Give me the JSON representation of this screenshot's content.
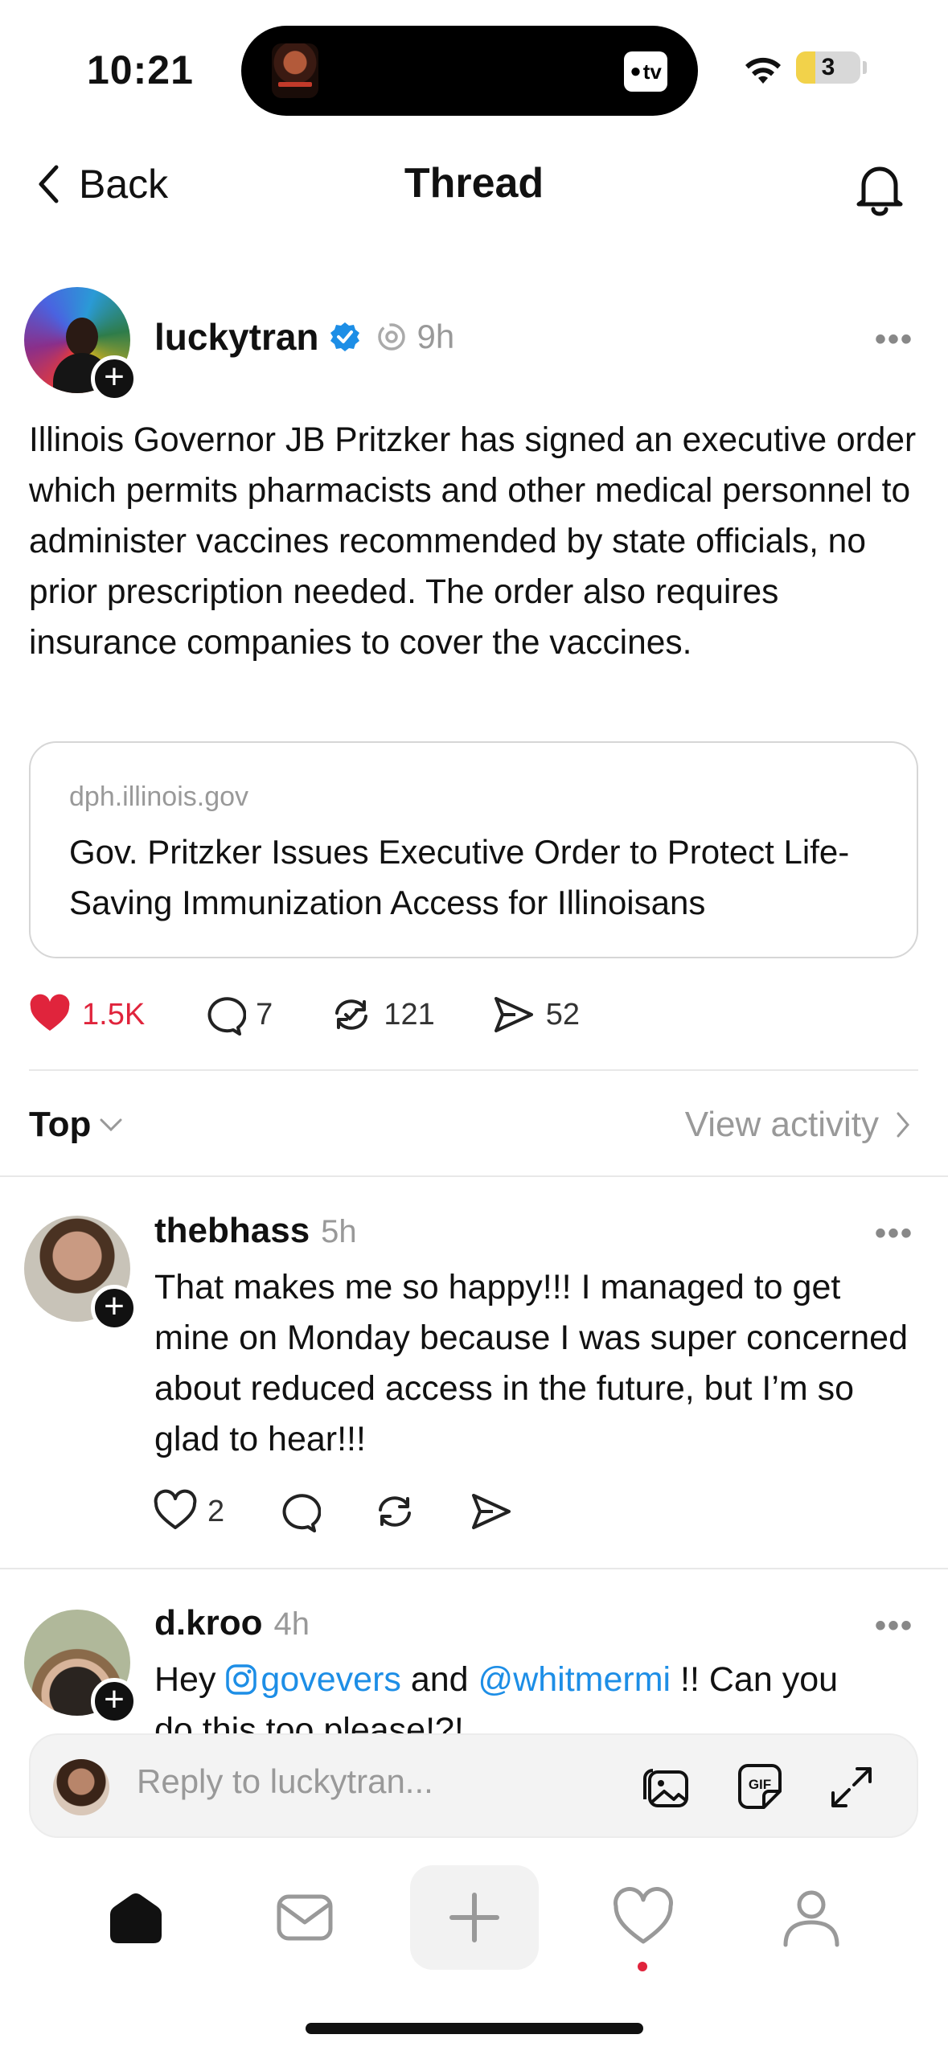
{
  "status_bar": {
    "time": "10:21",
    "tv_label": "tv",
    "battery_level": "3",
    "battery_fraction": 0.3
  },
  "nav": {
    "back_label": "Back",
    "title": "Thread"
  },
  "post": {
    "username": "luckytran",
    "timestamp": "9h",
    "text": "Illinois Governor JB Pritzker has signed an executive order which permits pharmacists and other medical personnel to administer vaccines recommended by state officials, no prior prescription needed. The order also requires insurance companies to cover the vaccines.",
    "link": {
      "domain": "dph.illinois.gov",
      "title": "Gov. Pritzker Issues Executive Order to Protect Life-Saving Immunization Access for Illinoisans"
    },
    "likes": "1.5K",
    "comments": "7",
    "reposts": "121",
    "shares": "52",
    "like_color": "#e0243c"
  },
  "sort": {
    "label": "Top",
    "view_activity": "View activity"
  },
  "replies": [
    {
      "username": "thebhass",
      "timestamp": "5h",
      "text": "That makes me so happy!!! I managed to get mine on Monday because I was super concerned about reduced access in the future, but I’m so glad to hear!!!",
      "likes": "2"
    },
    {
      "username": "d.kroo",
      "timestamp": "4h",
      "text_prefix": "Hey ",
      "mention1": "govevers",
      "text_mid": " and ",
      "mention2": "@whitmermi",
      "text_suffix": " !! Can you",
      "text_line2": "do this too please!?!"
    }
  ],
  "composer": {
    "placeholder": "Reply to luckytran..."
  },
  "accent": "#1d8ee6"
}
